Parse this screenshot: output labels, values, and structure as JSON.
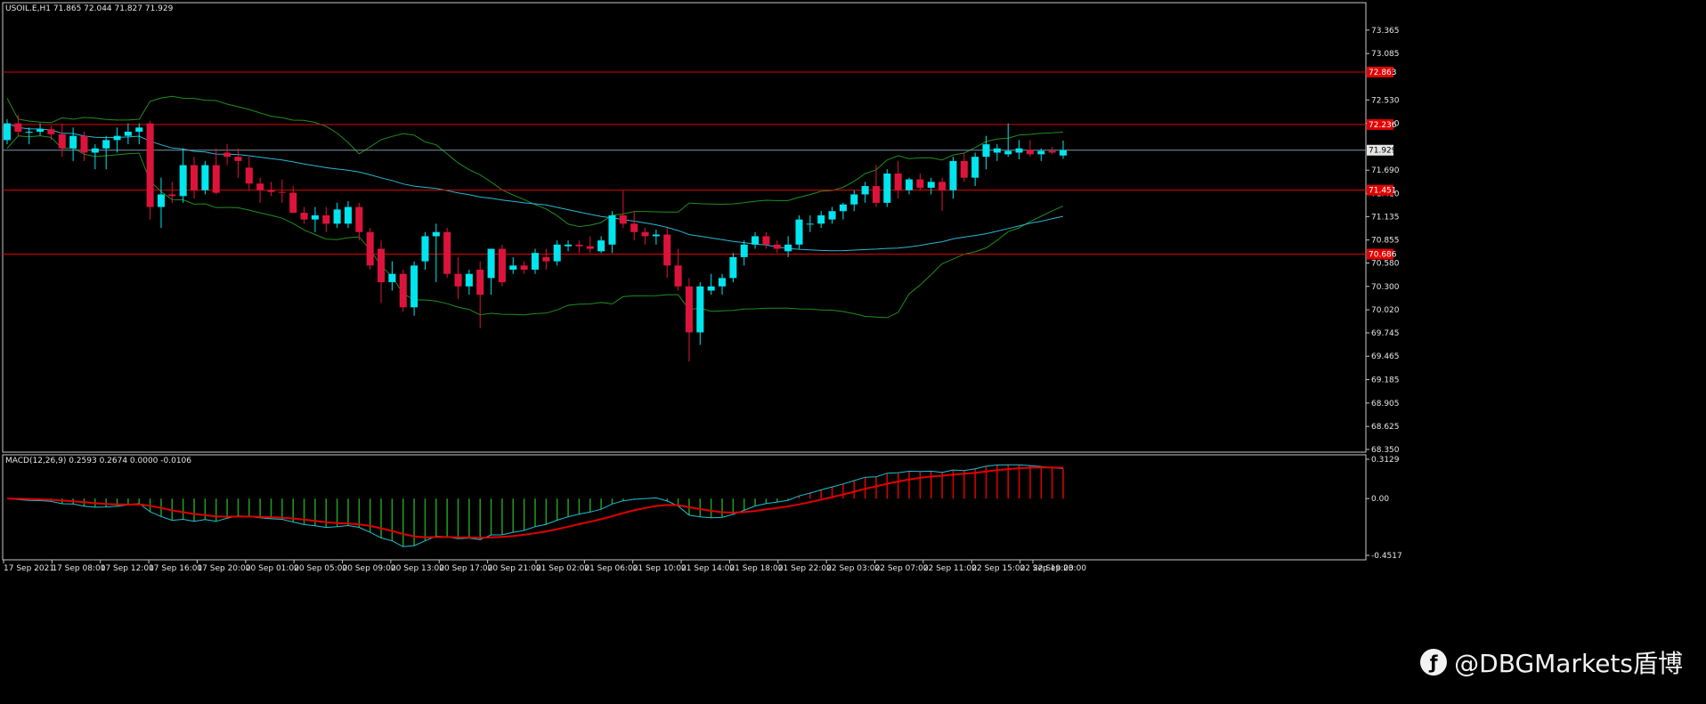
{
  "header": {
    "symbol_line": "USOIL.E,H1  71.865 72.044 71.827 71.929",
    "indicator_line": "MACD(12,26,9) 0.2593 0.2674 0.0000 -0.0106"
  },
  "watermark": {
    "text": "@DBGMarkets盾博",
    "logo_icon": "weibo-logo-icon"
  },
  "colors": {
    "bull": "#00e5ee",
    "bear": "#dc143c",
    "bands": "#1f8f1f",
    "ma": "#2bb7d6",
    "hline": "#e00000",
    "price_line": "#7d94a8",
    "macd_line": "#e00000",
    "signal_line": "#20c0d0"
  },
  "chart_data": {
    "type": "candlestick",
    "symbol": "USOIL.E",
    "timeframe": "H1",
    "ohlc_current": {
      "open": 71.865,
      "high": 72.044,
      "low": 71.827,
      "close": 71.929
    },
    "ylim": [
      68.35,
      73.64
    ],
    "y_ticks": [
      "73.365",
      "73.085",
      "72.530",
      "72.250",
      "71.690",
      "71.410",
      "71.135",
      "70.855",
      "70.580",
      "70.300",
      "70.020",
      "69.745",
      "69.465",
      "69.185",
      "68.905",
      "68.625",
      "68.350"
    ],
    "x_ticks": [
      "17 Sep 2021",
      "17 Sep 08:00",
      "17 Sep 12:00",
      "17 Sep 16:00",
      "17 Sep 20:00",
      "20 Sep 01:00",
      "20 Sep 05:00",
      "20 Sep 09:00",
      "20 Sep 13:00",
      "20 Sep 17:00",
      "20 Sep 21:00",
      "21 Sep 02:00",
      "21 Sep 06:00",
      "21 Sep 10:00",
      "21 Sep 14:00",
      "21 Sep 18:00",
      "21 Sep 22:00",
      "22 Sep 03:00",
      "22 Sep 07:00",
      "22 Sep 11:00",
      "22 Sep 15:00",
      "22 Sep 19:00",
      "22 Sep 23:00"
    ],
    "hlines": [
      {
        "price": 72.863,
        "label": "72.863"
      },
      {
        "price": 72.236,
        "label": "72.236"
      },
      {
        "price": 71.451,
        "label": "71.451"
      },
      {
        "price": 70.686,
        "label": "70.686"
      }
    ],
    "current_price": {
      "price": 71.929,
      "label": "71.929"
    },
    "candles": [
      [
        72.05,
        72.3,
        72.0,
        72.25
      ],
      [
        72.25,
        72.35,
        72.1,
        72.15
      ],
      [
        72.15,
        72.2,
        72.0,
        72.15
      ],
      [
        72.15,
        72.25,
        72.1,
        72.18
      ],
      [
        72.18,
        72.22,
        72.05,
        72.12
      ],
      [
        72.12,
        72.25,
        71.85,
        71.95
      ],
      [
        71.95,
        72.2,
        71.8,
        72.1
      ],
      [
        72.1,
        72.15,
        71.8,
        71.9
      ],
      [
        71.9,
        72.0,
        71.7,
        71.95
      ],
      [
        71.95,
        72.1,
        71.7,
        72.05
      ],
      [
        72.05,
        72.2,
        71.9,
        72.1
      ],
      [
        72.1,
        72.25,
        72.0,
        72.15
      ],
      [
        72.15,
        72.25,
        72.0,
        72.2
      ],
      [
        72.25,
        72.28,
        71.1,
        71.25
      ],
      [
        71.25,
        71.6,
        71.0,
        71.4
      ],
      [
        71.4,
        71.55,
        71.3,
        71.38
      ],
      [
        71.38,
        71.95,
        71.3,
        71.75
      ],
      [
        71.75,
        71.85,
        71.35,
        71.45
      ],
      [
        71.45,
        71.8,
        71.4,
        71.75
      ],
      [
        71.75,
        71.95,
        71.4,
        71.42
      ],
      [
        71.9,
        72.0,
        71.75,
        71.85
      ],
      [
        71.85,
        71.95,
        71.6,
        71.8
      ],
      [
        71.72,
        71.85,
        71.45,
        71.53
      ],
      [
        71.53,
        71.6,
        71.3,
        71.45
      ],
      [
        71.45,
        71.55,
        71.38,
        71.43
      ],
      [
        71.43,
        71.58,
        71.3,
        71.42
      ],
      [
        71.42,
        71.5,
        71.2,
        71.18
      ],
      [
        71.18,
        71.25,
        71.05,
        71.1
      ],
      [
        71.1,
        71.25,
        70.95,
        71.15
      ],
      [
        71.15,
        71.25,
        70.95,
        71.05
      ],
      [
        71.05,
        71.3,
        71.0,
        71.22
      ],
      [
        71.05,
        71.32,
        71.0,
        71.25
      ],
      [
        71.25,
        71.3,
        70.85,
        70.95
      ],
      [
        70.95,
        71.0,
        70.5,
        70.55
      ],
      [
        70.75,
        70.85,
        70.1,
        70.35
      ],
      [
        70.35,
        70.6,
        70.25,
        70.45
      ],
      [
        70.45,
        70.5,
        70.0,
        70.05
      ],
      [
        70.05,
        70.6,
        69.95,
        70.55
      ],
      [
        70.6,
        70.95,
        70.5,
        70.9
      ],
      [
        70.9,
        71.05,
        70.35,
        70.95
      ],
      [
        70.95,
        71.0,
        70.4,
        70.45
      ],
      [
        70.45,
        70.65,
        70.15,
        70.3
      ],
      [
        70.3,
        70.5,
        70.2,
        70.45
      ],
      [
        70.5,
        70.6,
        69.8,
        70.2
      ],
      [
        70.4,
        70.7,
        70.2,
        70.75
      ],
      [
        70.75,
        70.8,
        70.3,
        70.35
      ],
      [
        70.5,
        70.65,
        70.45,
        70.55
      ],
      [
        70.55,
        70.6,
        70.45,
        70.5
      ],
      [
        70.5,
        70.75,
        70.45,
        70.7
      ],
      [
        70.65,
        70.75,
        70.5,
        70.6
      ],
      [
        70.6,
        70.85,
        70.55,
        70.8
      ],
      [
        70.78,
        70.85,
        70.72,
        70.8
      ],
      [
        70.8,
        70.85,
        70.7,
        70.78
      ],
      [
        70.78,
        70.9,
        70.7,
        70.75
      ],
      [
        70.72,
        70.9,
        70.7,
        70.85
      ],
      [
        70.8,
        71.2,
        70.7,
        71.15
      ],
      [
        71.15,
        71.45,
        71.0,
        71.05
      ],
      [
        71.05,
        71.2,
        70.85,
        70.95
      ],
      [
        70.95,
        71.0,
        70.8,
        70.9
      ],
      [
        70.9,
        70.98,
        70.8,
        70.92
      ],
      [
        70.92,
        71.0,
        70.4,
        70.55
      ],
      [
        70.55,
        70.75,
        70.25,
        70.3
      ],
      [
        70.3,
        70.4,
        69.4,
        69.75
      ],
      [
        69.75,
        70.35,
        69.6,
        70.3
      ],
      [
        70.25,
        70.45,
        70.2,
        70.3
      ],
      [
        70.3,
        70.45,
        70.2,
        70.4
      ],
      [
        70.4,
        70.7,
        70.35,
        70.65
      ],
      [
        70.65,
        70.85,
        70.55,
        70.8
      ],
      [
        70.8,
        70.95,
        70.75,
        70.9
      ],
      [
        70.9,
        70.95,
        70.75,
        70.8
      ],
      [
        70.8,
        70.85,
        70.7,
        70.75
      ],
      [
        70.72,
        70.9,
        70.65,
        70.8
      ],
      [
        70.8,
        71.15,
        70.75,
        71.1
      ],
      [
        71.05,
        71.15,
        70.95,
        71.05
      ],
      [
        71.05,
        71.2,
        71.0,
        71.15
      ],
      [
        71.1,
        71.25,
        71.05,
        71.2
      ],
      [
        71.2,
        71.3,
        71.1,
        71.28
      ],
      [
        71.28,
        71.45,
        71.2,
        71.4
      ],
      [
        71.4,
        71.55,
        71.3,
        71.5
      ],
      [
        71.5,
        71.75,
        71.25,
        71.3
      ],
      [
        71.3,
        71.7,
        71.25,
        71.65
      ],
      [
        71.65,
        71.8,
        71.35,
        71.45
      ],
      [
        71.45,
        71.6,
        71.4,
        71.58
      ],
      [
        71.58,
        71.65,
        71.45,
        71.48
      ],
      [
        71.48,
        71.6,
        71.4,
        71.55
      ],
      [
        71.55,
        71.6,
        71.2,
        71.45
      ],
      [
        71.45,
        71.85,
        71.35,
        71.8
      ],
      [
        71.8,
        71.9,
        71.55,
        71.6
      ],
      [
        71.6,
        71.9,
        71.5,
        71.85
      ],
      [
        71.85,
        72.1,
        71.7,
        72.0
      ],
      [
        71.9,
        72.0,
        71.8,
        71.95
      ],
      [
        71.88,
        72.25,
        71.85,
        71.92
      ],
      [
        71.9,
        72.05,
        71.82,
        71.95
      ],
      [
        71.93,
        72.05,
        71.85,
        71.88
      ],
      [
        71.88,
        71.95,
        71.8,
        71.92
      ],
      [
        71.92,
        71.97,
        71.88,
        71.9
      ],
      [
        71.865,
        72.044,
        71.827,
        71.929
      ]
    ],
    "macd_ylim": [
      -0.4517,
      0.3129
    ],
    "macd_y_ticks": [
      "0.3129",
      "0.00",
      "-0.4517"
    ]
  }
}
